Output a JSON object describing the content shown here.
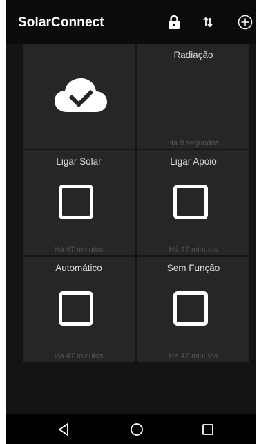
{
  "app": {
    "title": "SolarConnect"
  },
  "actions": [
    {
      "icon": "lock-icon"
    },
    {
      "icon": "sort-arrows-icon"
    },
    {
      "icon": "add-circle-icon"
    }
  ],
  "tiles": [
    {
      "title": "",
      "time": "",
      "icon": "cloud-check-icon"
    },
    {
      "title": "Radiação",
      "time": "Há 9 segundos"
    },
    {
      "title": "Ligar Solar",
      "time": "Há 47 minutos",
      "checked": false
    },
    {
      "title": "Ligar Apoio",
      "time": "Há 47 minutos",
      "checked": false
    },
    {
      "title": "Automático",
      "time": "Há 47 minutos",
      "checked": false
    },
    {
      "title": "Sem Função",
      "time": "Há 47 minutos",
      "checked": false
    }
  ],
  "navbar": [
    {
      "icon": "back-triangle-icon"
    },
    {
      "icon": "home-circle-icon"
    },
    {
      "icon": "recents-square-icon"
    }
  ],
  "colors": {
    "appbar": "#0b0b0b",
    "background": "#141414",
    "tile": "#262626",
    "text": "#dcdcdc",
    "muted": "#555555"
  }
}
